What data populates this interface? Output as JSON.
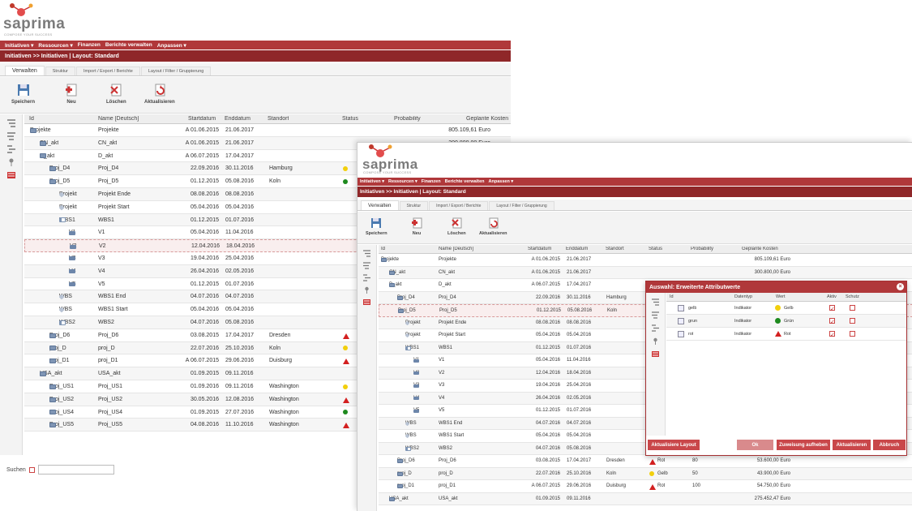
{
  "brand": {
    "name": "saprima",
    "tagline": "COMPOSE YOUR SUCCESS"
  },
  "menu": [
    "Initiativen ▾",
    "Ressourcen ▾",
    "Finanzen",
    "Berichte verwalten",
    "Anpassen ▾"
  ],
  "title": "Initiativen >> Initiativen | Layout: Standard",
  "tabs": [
    "Verwalten",
    "Struktur",
    "Import / Export / Berichte",
    "Layout / Filter / Gruppierung"
  ],
  "toolbar": {
    "save": "Speichern",
    "new": "Neu",
    "delete": "Löschen",
    "refresh": "Aktualisieren"
  },
  "columns": {
    "id": "Id",
    "name": "Name [Deutsch]",
    "start": "Startdatum",
    "end": "Enddatum",
    "loc": "Standort",
    "status": "Status",
    "prob": "Probability",
    "cost": "Geplante Kosten"
  },
  "rows": [
    {
      "id": "Projekte",
      "name": "Projekte",
      "start": "A 01.06.2015",
      "end": "21.06.2017",
      "loc": "",
      "status": "",
      "status_text": "",
      "prob": "",
      "cost": "805.109,61 Euro"
    },
    {
      "id": "CN_akt",
      "name": "CN_akt",
      "start": "A 01.06.2015",
      "end": "21.06.2017",
      "loc": "",
      "status": "",
      "status_text": "",
      "prob": "",
      "cost": "300.800,00 Euro"
    },
    {
      "id": "D_akt",
      "name": "D_akt",
      "start": "A 06.07.2015",
      "end": "17.04.2017",
      "loc": "",
      "status": "",
      "status_text": "",
      "prob": "",
      "cost": ""
    },
    {
      "id": "Proj_D4",
      "name": "Proj_D4",
      "start": "22.09.2016",
      "end": "30.11.2016",
      "loc": "Hamburg",
      "status": "yellow",
      "status_text": "",
      "prob": "",
      "cost": ""
    },
    {
      "id": "Proj_D5",
      "name": "Proj_D5",
      "start": "01.12.2015",
      "end": "05.08.2016",
      "loc": "Koln",
      "status": "green",
      "status_text": "",
      "prob": "",
      "cost": ""
    },
    {
      "id": "Projekt",
      "name": "Projekt Ende",
      "start": "08.08.2016",
      "end": "08.08.2016",
      "loc": "",
      "status": "",
      "status_text": "",
      "prob": "",
      "cost": ""
    },
    {
      "id": "Projekt",
      "name": "Projekt Start",
      "start": "05.04.2016",
      "end": "05.04.2016",
      "loc": "",
      "status": "",
      "status_text": "",
      "prob": "",
      "cost": ""
    },
    {
      "id": "WBS1",
      "name": "WBS1",
      "start": "01.12.2015",
      "end": "01.07.2016",
      "loc": "",
      "status": "",
      "status_text": "",
      "prob": "",
      "cost": ""
    },
    {
      "id": "V1",
      "name": "V1",
      "start": "05.04.2016",
      "end": "11.04.2016",
      "loc": "",
      "status": "",
      "status_text": "",
      "prob": "",
      "cost": ""
    },
    {
      "id": "V2",
      "name": "V2",
      "start": "12.04.2016",
      "end": "18.04.2016",
      "loc": "",
      "status": "",
      "status_text": "",
      "prob": "",
      "cost": ""
    },
    {
      "id": "V3",
      "name": "V3",
      "start": "19.04.2016",
      "end": "25.04.2016",
      "loc": "",
      "status": "",
      "status_text": "",
      "prob": "",
      "cost": ""
    },
    {
      "id": "V4",
      "name": "V4",
      "start": "26.04.2016",
      "end": "02.05.2016",
      "loc": "",
      "status": "",
      "status_text": "",
      "prob": "",
      "cost": ""
    },
    {
      "id": "V5",
      "name": "V5",
      "start": "01.12.2015",
      "end": "01.07.2016",
      "loc": "",
      "status": "",
      "status_text": "",
      "prob": "",
      "cost": ""
    },
    {
      "id": "WBS",
      "name": "WBS1 End",
      "start": "04.07.2016",
      "end": "04.07.2016",
      "loc": "",
      "status": "",
      "status_text": "",
      "prob": "",
      "cost": ""
    },
    {
      "id": "WBS",
      "name": "WBS1 Start",
      "start": "05.04.2016",
      "end": "05.04.2016",
      "loc": "",
      "status": "",
      "status_text": "",
      "prob": "",
      "cost": ""
    },
    {
      "id": "WBS2",
      "name": "WBS2",
      "start": "04.07.2016",
      "end": "05.08.2016",
      "loc": "",
      "status": "",
      "status_text": "",
      "prob": "",
      "cost": ""
    },
    {
      "id": "Proj_D6",
      "name": "Proj_D6",
      "start": "03.08.2015",
      "end": "17.04.2017",
      "loc": "Dresden",
      "status": "red",
      "status_text": "Rot",
      "prob": "80",
      "cost": "53.600,00 Euro"
    },
    {
      "id": "proj_D",
      "name": "proj_D",
      "start": "22.07.2016",
      "end": "25.10.2016",
      "loc": "Koln",
      "status": "yellow",
      "status_text": "Gelb",
      "prob": "50",
      "cost": "43.900,00 Euro"
    },
    {
      "id": "proj_D1",
      "name": "proj_D1",
      "start": "A 06.07.2015",
      "end": "29.06.2016",
      "loc": "Duisburg",
      "status": "red",
      "status_text": "Rot",
      "prob": "100",
      "cost": "54.750,00 Euro"
    },
    {
      "id": "USA_akt",
      "name": "USA_akt",
      "start": "01.09.2015",
      "end": "09.11.2016",
      "loc": "",
      "status": "",
      "status_text": "",
      "prob": "",
      "cost": "275.452,47 Euro"
    },
    {
      "id": "Proj_US1",
      "name": "Proj_US1",
      "start": "01.09.2016",
      "end": "09.11.2016",
      "loc": "Washington",
      "status": "yellow",
      "status_text": "",
      "prob": "",
      "cost": ""
    },
    {
      "id": "Proj_US2",
      "name": "Proj_US2",
      "start": "30.05.2016",
      "end": "12.08.2016",
      "loc": "Washington",
      "status": "red",
      "status_text": "",
      "prob": "",
      "cost": ""
    },
    {
      "id": "Proj_US4",
      "name": "Proj_US4",
      "start": "01.09.2015",
      "end": "27.07.2016",
      "loc": "Washington",
      "status": "green",
      "status_text": "",
      "prob": "",
      "cost": ""
    },
    {
      "id": "Proj_US5",
      "name": "Proj_US5",
      "start": "04.08.2016",
      "end": "11.10.2016",
      "loc": "Washington",
      "status": "red",
      "status_text": "",
      "prob": "",
      "cost": ""
    }
  ],
  "search_label": "Suchen",
  "dialog": {
    "title": "Auswahl: Erweiterte Attributwerte",
    "columns": {
      "id": "Id",
      "type": "Datentyp",
      "value": "Wert",
      "active": "Aktiv",
      "protect": "Schutz"
    },
    "rows": [
      {
        "id": "gelb",
        "type": "Indikator",
        "value": "Gelb",
        "color": "yellow",
        "active": true,
        "protect": false
      },
      {
        "id": "grun",
        "type": "Indikator",
        "value": "Grün",
        "color": "green",
        "active": true,
        "protect": false
      },
      {
        "id": "rot",
        "type": "Indikator",
        "value": "Rot",
        "color": "red",
        "active": true,
        "protect": false
      }
    ],
    "buttons": {
      "layout": "Aktualisiere Layout",
      "ok": "Ok",
      "unassign": "Zuweisung aufheben",
      "refresh": "Aktualisieren",
      "cancel": "Abbruch"
    }
  },
  "colors": {
    "menu": "#b0383a",
    "title": "#8f2729",
    "yellow": "#f2cf0c",
    "green": "#1e8a1e",
    "red": "#d32020"
  }
}
